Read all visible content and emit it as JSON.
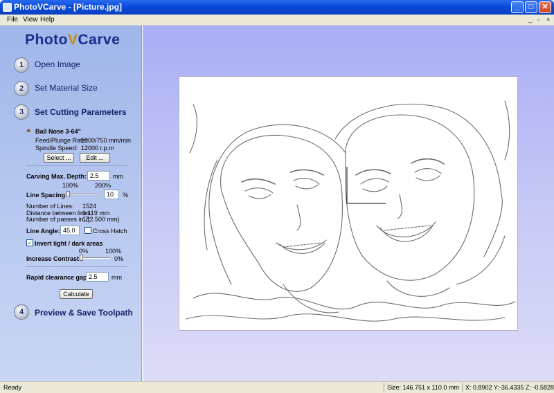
{
  "window": {
    "title": "PhotoVCarve - [Picture.jpg]"
  },
  "menu": {
    "items": [
      "File",
      "View",
      "Help"
    ]
  },
  "logo": {
    "part1": "Photo",
    "part2": "V",
    "part3": "Carve"
  },
  "steps": [
    {
      "number": "1",
      "label": "Open Image"
    },
    {
      "number": "2",
      "label": "Set Material Size"
    },
    {
      "number": "3",
      "label": "Set Cutting Parameters"
    },
    {
      "number": "4",
      "label": "Preview & Save Toolpath"
    }
  ],
  "tool": {
    "name": "Ball Nose 3-64\"",
    "feed_label": "Feed/Plunge Rate:",
    "feed_value": "1800/750 mm/min",
    "spindle_label": "Spindle Speed:",
    "spindle_value": "12000 r.p.m",
    "select_button": "Select ...",
    "edit_button": "Edit ..."
  },
  "params": {
    "depth_label": "Carving Max. Depth:",
    "depth_value": "2.5",
    "depth_unit": "mm",
    "scale_left": "100%",
    "scale_right": "200%",
    "line_spacing_label": "Line Spacing",
    "line_spacing_value": "10",
    "line_spacing_unit": "%",
    "line_spacing_level": 0.02,
    "num_lines_label": "Number of Lines:",
    "num_lines_value": "1524",
    "distance_label": "Distance between lines:",
    "distance_value": "0.119 mm",
    "passes_label": "Number of passes in Z:",
    "passes_value": "1 (2.500 mm)",
    "line_angle_label": "Line Angle:",
    "line_angle_value": "45.0",
    "cross_hatch_label": "Cross Hatch",
    "cross_hatch_checked": false,
    "invert_label": "Invert light / dark areas",
    "invert_checked": true,
    "contrast_left": "0%",
    "contrast_right": "100%",
    "contrast_label": "Increase Contrast",
    "contrast_value": "0%",
    "contrast_level": 0.0,
    "rapid_label": "Rapid clearance gap:",
    "rapid_value": "2.5",
    "rapid_unit": "mm",
    "calculate_button": "Calculate"
  },
  "status": {
    "ready": "Ready",
    "size": "Size: 146.751 x 110.0 mm",
    "coords": "X:  0.8902 Y:-36.4335 Z: -0.5828"
  },
  "colors": {
    "sidebar_top": "#9fb6ea",
    "main_top": "#a9aef5",
    "logo_blue": "#1c2a8c",
    "logo_v": "#c98a12"
  }
}
